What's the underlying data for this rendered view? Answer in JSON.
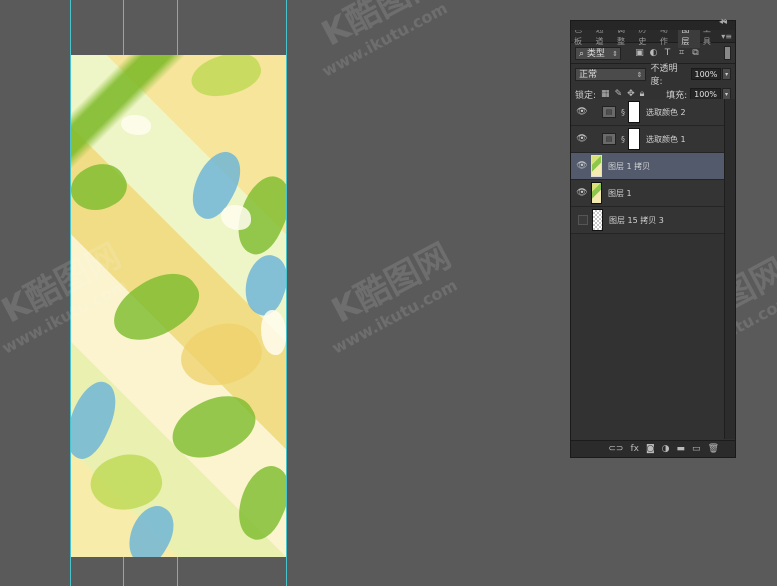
{
  "watermark": {
    "logo": "K酷图网",
    "url": "www.ikutu.com"
  },
  "panel": {
    "collapse_glyph": "◂◂",
    "close_glyph": "✕",
    "tabs": [
      {
        "label": "色板"
      },
      {
        "label": "通道"
      },
      {
        "label": "调整"
      },
      {
        "label": "历史"
      },
      {
        "label": "动作"
      },
      {
        "label": "图层"
      },
      {
        "label": "工具"
      }
    ],
    "active_tab": "图层",
    "menu_glyph": "▾≡",
    "filter": {
      "type_label": "类型",
      "arrow": "⇕"
    },
    "blend": {
      "mode": "正常",
      "arrow": "⇕",
      "opacity_label": "不透明度:",
      "opacity": "100%",
      "dropdown_arrow": "▾"
    },
    "lock": {
      "label": "锁定:",
      "fill_label": "填充:",
      "fill": "100%",
      "dropdown_arrow": "▾"
    },
    "layers": [
      {
        "name": "选取颜色 2",
        "visible": true,
        "kind": "adjustment"
      },
      {
        "name": "选取颜色 1",
        "visible": true,
        "kind": "adjustment"
      },
      {
        "name": "图层 1 拷贝",
        "visible": true,
        "kind": "pixel",
        "selected": true
      },
      {
        "name": "图层 1",
        "visible": true,
        "kind": "pixel"
      },
      {
        "name": "图层 15 拷贝 3",
        "visible": false,
        "kind": "checker"
      }
    ],
    "bottom_icons": [
      "link-icon",
      "fx-icon",
      "mask-icon",
      "adjustment-icon",
      "folder-icon",
      "new-layer-icon",
      "trash-icon"
    ],
    "colors": {
      "panel_bg": "#323232",
      "selected_row": "#525a6c",
      "guide": "#46d6e0",
      "canvas_bg": "#5a5a5a"
    }
  }
}
